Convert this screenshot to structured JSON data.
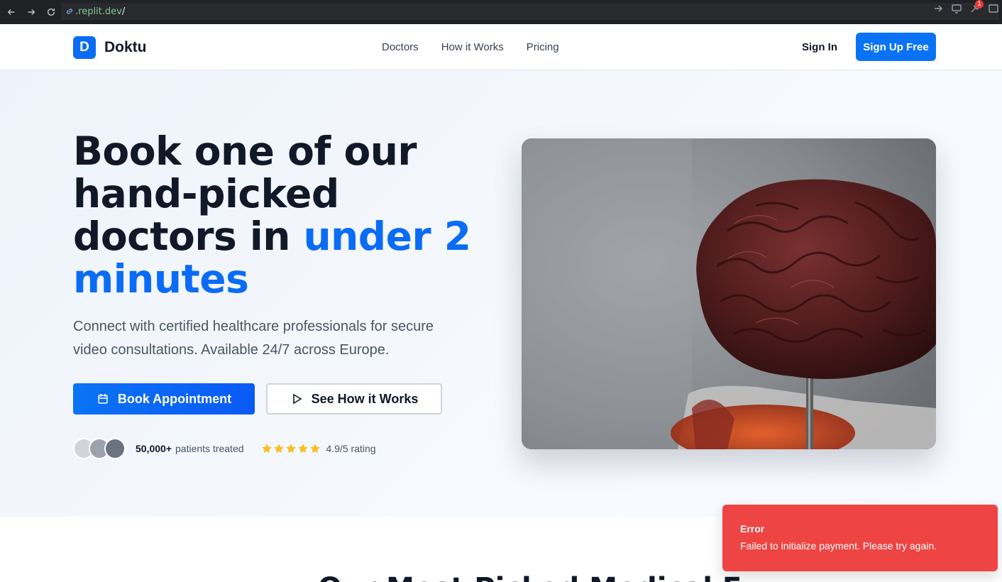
{
  "browser": {
    "url_host": ".replit.dev",
    "url_path": "/",
    "notification_count": "1"
  },
  "header": {
    "logo_letter": "D",
    "brand": "Doktu",
    "nav": [
      "Doctors",
      "How it Works",
      "Pricing"
    ],
    "sign_in": "Sign In",
    "sign_up": "Sign Up Free"
  },
  "hero": {
    "title_part1": "Book one of our hand-picked doctors in ",
    "title_accent": "under 2 minutes",
    "subtitle": "Connect with certified healthcare professionals for secure video consultations. Available 24/7 across Europe.",
    "book_button": "Book Appointment",
    "how_button": "See How it Works",
    "patients_count": "50,000+",
    "patients_label": "patients treated",
    "rating": "4.9/5 rating",
    "star_count": 5,
    "avatar_colors": [
      "#d1d5db",
      "#9ca3af",
      "#6b7280"
    ]
  },
  "section": {
    "heading": "Our Most Picked Medical E"
  },
  "toast": {
    "title": "Error",
    "message": "Failed to initialize payment. Please try again."
  },
  "colors": {
    "accent": "#0a6cf5",
    "error": "#ef4444",
    "star": "#fbbf24"
  }
}
